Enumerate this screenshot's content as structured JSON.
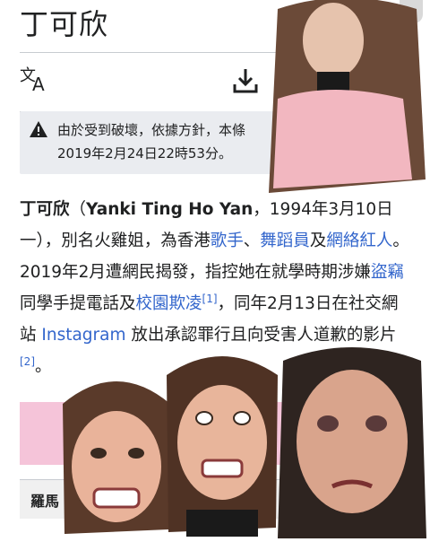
{
  "page": {
    "title": "丁可欣"
  },
  "toolbar": {
    "language_icon": "translate-icon",
    "download_icon": "download-icon",
    "lock_icon": "lock-icon"
  },
  "notice": {
    "icon": "warning-icon",
    "line1": "由於受到破壞，依據方針，本條",
    "line2": "2019年2月24日22時53分。"
  },
  "article": {
    "name": "丁可欣",
    "paren_open": "（",
    "english_name": "Yanki Ting Ho Yan",
    "birth": "，1994年3月10日一），別名火雞姐，為香港",
    "link_singer": "歌手",
    "sep1": "、",
    "link_dancer": "舞蹈員",
    "and1": "及",
    "link_influencer": "網絡紅人",
    "text2": "。2019年2月遭網民揭發，指控她在就學時期涉嫌",
    "link_theft": "盜竊",
    "text3": "同學手提電話及",
    "link_bullying": "校園欺凌",
    "ref1": "[1]",
    "text4": "，同年2月13日在社交網站 ",
    "link_instagram": "Instagram",
    "text5": " 放出承認罪行且向受害人道歉的影片",
    "ref2": "[2]",
    "text6": "。"
  },
  "infobox": {
    "row_label": "羅馬"
  },
  "colors": {
    "link": "#3366cc",
    "infobox_band": "#f5c4d9",
    "notice_bg": "#eaecf0"
  }
}
